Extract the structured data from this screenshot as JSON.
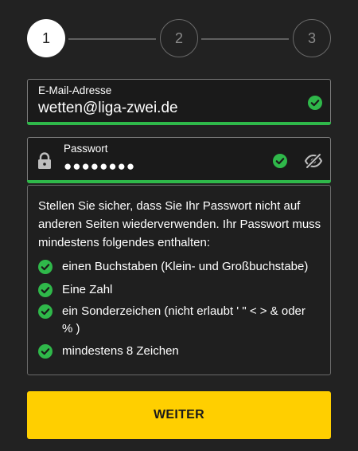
{
  "stepper": {
    "steps": [
      "1",
      "2",
      "3"
    ],
    "active_step": "1"
  },
  "email": {
    "label": "E-Mail-Adresse",
    "value": "wetten@liga-zwei.de",
    "valid": true
  },
  "password": {
    "label": "Passwort",
    "value": "●●●●●●●●",
    "valid": true,
    "visibility": "hidden"
  },
  "rules": {
    "intro": "Stellen Sie sicher, dass Sie Ihr Passwort nicht auf anderen Seiten wiederverwenden. Ihr Passwort muss mindestens folgendes enthalten:",
    "items": [
      {
        "text": "einen Buchstaben (Klein- und Großbuchstabe)",
        "met": true
      },
      {
        "text": "Eine Zahl",
        "met": true
      },
      {
        "text": "ein Sonderzeichen (nicht erlaubt ' \" < > & oder % )",
        "met": true
      },
      {
        "text": "mindestens 8 Zeichen",
        "met": true
      }
    ]
  },
  "submit": {
    "label": "WEITER"
  },
  "colors": {
    "background": "#222222",
    "accent": "#ffcf00",
    "success": "#2fb84a"
  },
  "icons": {
    "check": "check-circle-icon",
    "lock": "lock-icon",
    "visibility": "eye-off-icon"
  }
}
